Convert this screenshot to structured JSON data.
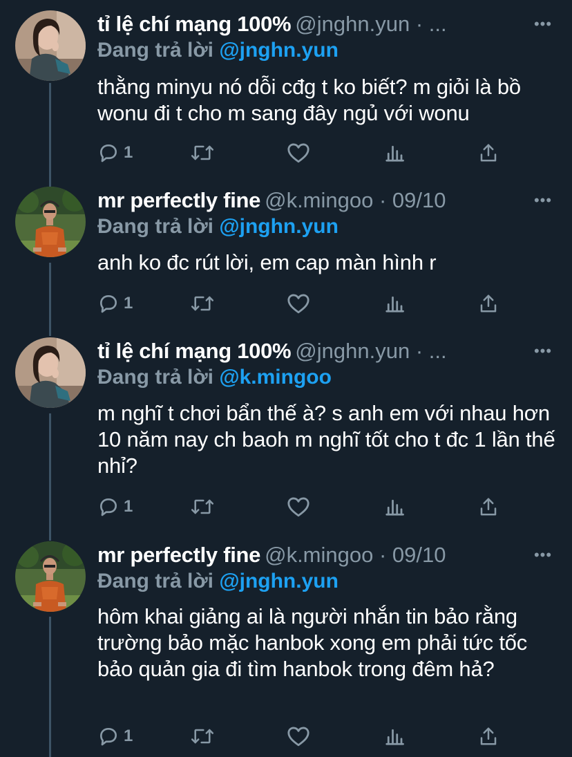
{
  "colors": {
    "background": "#15202b",
    "secondary_text": "#8899a6",
    "link": "#1da1f2",
    "thread_line": "#3d5466"
  },
  "tweets": [
    {
      "display_name": "tỉ lệ chí mạng 100%",
      "meta": "@jnghn.yun · ...",
      "reply_label": "Đang trả lời",
      "reply_to": "@jnghn.yun",
      "text": "thằng minyu nó dỗi cđg t ko biết? m giỏi là bồ wonu đi t cho m sang đây ngủ với wonu",
      "reply_count": "1",
      "avatar": "woman-avatar"
    },
    {
      "display_name": "mr perfectly fine",
      "meta": "@k.mingoo · 09/10",
      "reply_label": "Đang trả lời",
      "reply_to": "@jnghn.yun",
      "text": "anh ko đc rút lời, em cap màn hình r",
      "reply_count": "1",
      "avatar": "man-avatar"
    },
    {
      "display_name": "tỉ lệ chí mạng 100%",
      "meta": "@jnghn.yun · ...",
      "reply_label": "Đang trả lời",
      "reply_to": "@k.mingoo",
      "text": "m nghĩ t chơi bẩn thế à? s anh em với nhau hơn 10 năm nay ch baoh m nghĩ tốt cho t đc 1 lần thế nhỉ?",
      "reply_count": "1",
      "avatar": "woman-avatar"
    },
    {
      "display_name": "mr perfectly fine",
      "meta": "@k.mingoo · 09/10",
      "reply_label": "Đang trả lời",
      "reply_to": "@jnghn.yun",
      "text": "hôm khai giảng ai là người nhắn tin bảo rằng trường bảo mặc hanbok xong em phải tức tốc bảo quản gia đi tìm hanbok trong đêm hả?",
      "reply_count": "1",
      "avatar": "man-avatar"
    }
  ]
}
